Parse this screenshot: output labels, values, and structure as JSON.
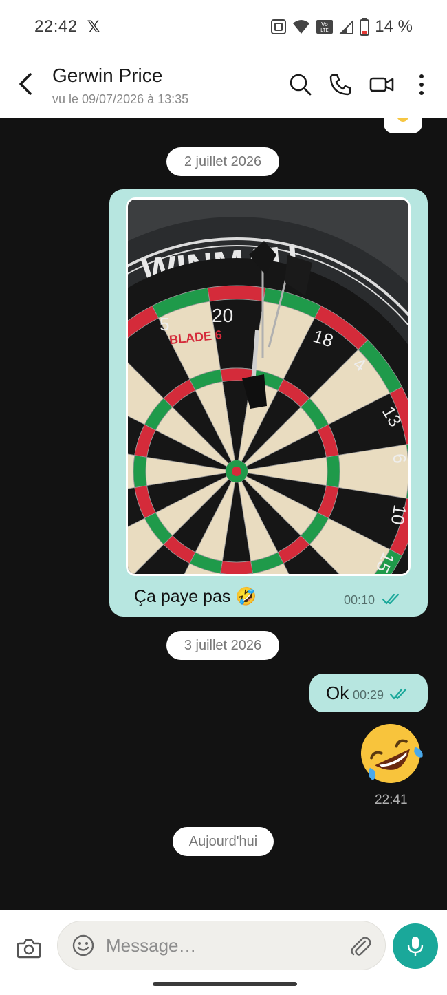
{
  "status_bar": {
    "time": "22:42",
    "x_app": "𝕏",
    "battery": "14 %"
  },
  "header": {
    "contact_name": "Gerwin Price",
    "last_seen": "vu le 09/07/2026 à 13:35"
  },
  "chat": {
    "date_separators": [
      "2 juillet 2026",
      "3 juillet 2026",
      "Aujourd'hui"
    ],
    "messages": [
      {
        "type": "image",
        "caption": "Ça paye pas 🤣",
        "time": "00:10",
        "status": "read",
        "photo": {
          "surround_text": "WINMAU",
          "board_numbers": [
            "20",
            "5",
            "18",
            "4",
            "13",
            "6",
            "10",
            "15"
          ],
          "board_brand": "BLADE 6"
        }
      },
      {
        "type": "text",
        "text": "Ok",
        "time": "00:29",
        "status": "read"
      },
      {
        "type": "emoji",
        "emoji": "🤣",
        "time": "22:41"
      }
    ]
  },
  "composer": {
    "placeholder": "Message…"
  },
  "colors": {
    "outgoing_bubble": "#b7e6e0",
    "accent": "#1aa89a",
    "chat_bg": "#121212"
  }
}
